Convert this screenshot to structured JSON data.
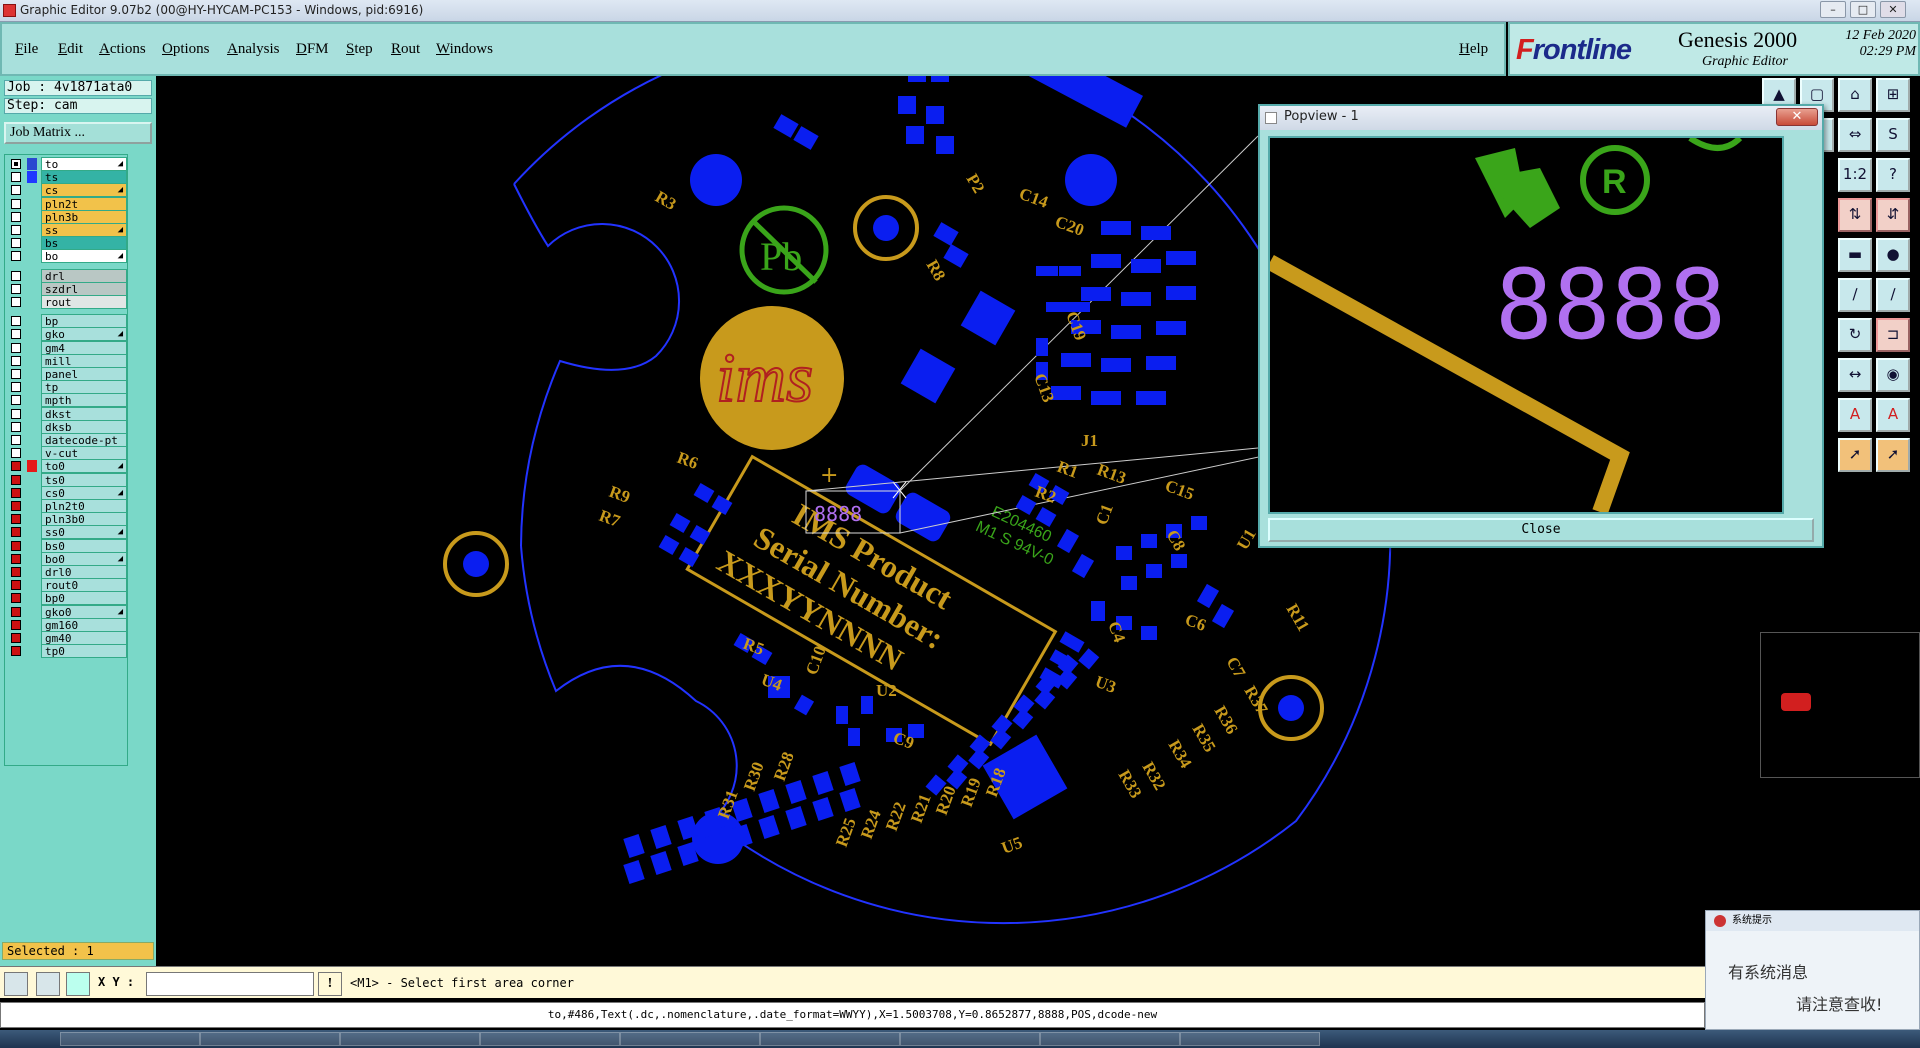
{
  "window": {
    "title": "Graphic Editor 9.07b2 (00@HY-HYCAM-PC153 - Windows, pid:6916)",
    "controls": [
      "–",
      "□",
      "✕"
    ]
  },
  "menu": [
    "File",
    "Edit",
    "Actions",
    "Options",
    "Analysis",
    "DFM",
    "Step",
    "Rout",
    "Windows"
  ],
  "help": "Help",
  "brand": {
    "logo_f": "F",
    "logo_rest": "rontline",
    "product": "Genesis 2000",
    "subtitle": "Graphic Editor",
    "date": "12 Feb 2020",
    "time": "02:29 PM"
  },
  "job": {
    "job_line": "Job : 4v1871ata0",
    "step_line": "Step: cam",
    "matrix_button": "Job Matrix ..."
  },
  "layers": [
    {
      "name": "to",
      "color": "#ffffff",
      "box": "white",
      "sw": "#2a49d0",
      "arrow": "◢"
    },
    {
      "name": "ts",
      "color": "#34b3a5",
      "box": "white",
      "sw": "#2039ff",
      "arrow": ""
    },
    {
      "name": "cs",
      "color": "#f2c24a",
      "box": "white",
      "sw": "",
      "arrow": "◢"
    },
    {
      "name": "pln2t",
      "color": "#f2c24a",
      "box": "white",
      "sw": "",
      "arrow": ""
    },
    {
      "name": "pln3b",
      "color": "#f2c24a",
      "box": "white",
      "sw": "",
      "arrow": ""
    },
    {
      "name": "ss",
      "color": "#f2c24a",
      "box": "white",
      "sw": "",
      "arrow": "◢"
    },
    {
      "name": "bs",
      "color": "#34b3a5",
      "box": "white",
      "sw": "",
      "arrow": ""
    },
    {
      "name": "bo",
      "color": "#ffffff",
      "box": "white",
      "sw": "",
      "arrow": "◢"
    },
    {
      "name": "drl",
      "color": "#b9c7c4",
      "box": "white",
      "sw": "",
      "arrow": ""
    },
    {
      "name": "szdrl",
      "color": "#b9c7c4",
      "box": "white",
      "sw": "",
      "arrow": ""
    },
    {
      "name": "rout",
      "color": "#e1e6e5",
      "box": "white",
      "sw": "",
      "arrow": ""
    },
    {
      "name": "bp",
      "color": "#a8e0dc",
      "box": "white",
      "sw": "",
      "arrow": ""
    },
    {
      "name": "gko",
      "color": "#a8e0dc",
      "box": "white",
      "sw": "",
      "arrow": "◢"
    },
    {
      "name": "gm4",
      "color": "#a8e0dc",
      "box": "white",
      "sw": "",
      "arrow": ""
    },
    {
      "name": "mill",
      "color": "#a8e0dc",
      "box": "white",
      "sw": "",
      "arrow": ""
    },
    {
      "name": "panel",
      "color": "#a8e0dc",
      "box": "white",
      "sw": "",
      "arrow": ""
    },
    {
      "name": "tp",
      "color": "#a8e0dc",
      "box": "white",
      "sw": "",
      "arrow": ""
    },
    {
      "name": "mpth",
      "color": "#a8e0dc",
      "box": "white",
      "sw": "",
      "arrow": ""
    },
    {
      "name": "dkst",
      "color": "#a8e0dc",
      "box": "white",
      "sw": "",
      "arrow": ""
    },
    {
      "name": "dksb",
      "color": "#a8e0dc",
      "box": "white",
      "sw": "",
      "arrow": ""
    },
    {
      "name": "datecode-pt",
      "color": "#a8e0dc",
      "box": "white",
      "sw": "",
      "arrow": ""
    },
    {
      "name": "v-cut",
      "color": "#a8e0dc",
      "box": "white",
      "sw": "",
      "arrow": ""
    },
    {
      "name": "to0",
      "color": "#a8e0dc",
      "box": "red",
      "sw": "#e61a1a",
      "arrow": "◢"
    },
    {
      "name": "ts0",
      "color": "#a8e0dc",
      "box": "red",
      "sw": "",
      "arrow": ""
    },
    {
      "name": "cs0",
      "color": "#a8e0dc",
      "box": "red",
      "sw": "",
      "arrow": "◢"
    },
    {
      "name": "pln2t0",
      "color": "#a8e0dc",
      "box": "red",
      "sw": "",
      "arrow": ""
    },
    {
      "name": "pln3b0",
      "color": "#a8e0dc",
      "box": "red",
      "sw": "",
      "arrow": ""
    },
    {
      "name": "ss0",
      "color": "#a8e0dc",
      "box": "red",
      "sw": "",
      "arrow": "◢"
    },
    {
      "name": "bs0",
      "color": "#a8e0dc",
      "box": "red",
      "sw": "",
      "arrow": ""
    },
    {
      "name": "bo0",
      "color": "#a8e0dc",
      "box": "red",
      "sw": "",
      "arrow": "◢"
    },
    {
      "name": "drl0",
      "color": "#a8e0dc",
      "box": "red",
      "sw": "",
      "arrow": ""
    },
    {
      "name": "rout0",
      "color": "#a8e0dc",
      "box": "red",
      "sw": "",
      "arrow": ""
    },
    {
      "name": "bp0",
      "color": "#a8e0dc",
      "box": "red",
      "sw": "",
      "arrow": ""
    },
    {
      "name": "gko0",
      "color": "#a8e0dc",
      "box": "red",
      "sw": "",
      "arrow": "◢"
    },
    {
      "name": "gm160",
      "color": "#a8e0dc",
      "box": "red",
      "sw": "",
      "arrow": ""
    },
    {
      "name": "gm40",
      "color": "#a8e0dc",
      "box": "red",
      "sw": "",
      "arrow": ""
    },
    {
      "name": "tp0",
      "color": "#a8e0dc",
      "box": "red",
      "sw": "",
      "arrow": ""
    }
  ],
  "selected": "Selected : 1",
  "xy_label": "X Y :",
  "xy_value": "",
  "prompt": "<M1> - Select first area corner",
  "status": "to,#486,Text(.dc,.nomenclature,.date_format=WWYY),X=1.5003708,Y=0.8652877,8888,POS,dcode-new",
  "popview": {
    "title": "Popview - 1",
    "close_x": "✕",
    "close": "Close",
    "digits": "8888"
  },
  "notification": {
    "title": "系统提示",
    "line1": "有系统消息",
    "line2": "请注意查收!"
  },
  "board_text": {
    "product": "IMS Product",
    "serial": "Serial Number:",
    "code": "XXXYYNNNN",
    "pb": "Pb",
    "ims": "ims",
    "rating1": "E204460",
    "rating2": "M1 S 94V-0",
    "refs": [
      "R3",
      "P2",
      "C14",
      "C20",
      "R8",
      "C19",
      "C13",
      "J1",
      "R1",
      "R13",
      "R2",
      "C15",
      "C1",
      "R6",
      "R9",
      "R7",
      "C8",
      "U1",
      "R11",
      "C6",
      "C4",
      "C7",
      "R5",
      "C10",
      "U4",
      "U2",
      "U3",
      "C9",
      "R37",
      "R36",
      "R35",
      "R34",
      "R32",
      "R33",
      "R30",
      "R28",
      "R31",
      "R25",
      "R24",
      "R22",
      "R21",
      "R20",
      "R19",
      "R18",
      "U5"
    ]
  },
  "colors": {
    "board_outline": "#2233ff",
    "pad": "#0a1ef0",
    "silk": "#c89a1c",
    "green": "#3aa51a",
    "accent": "#a8e0dc"
  }
}
